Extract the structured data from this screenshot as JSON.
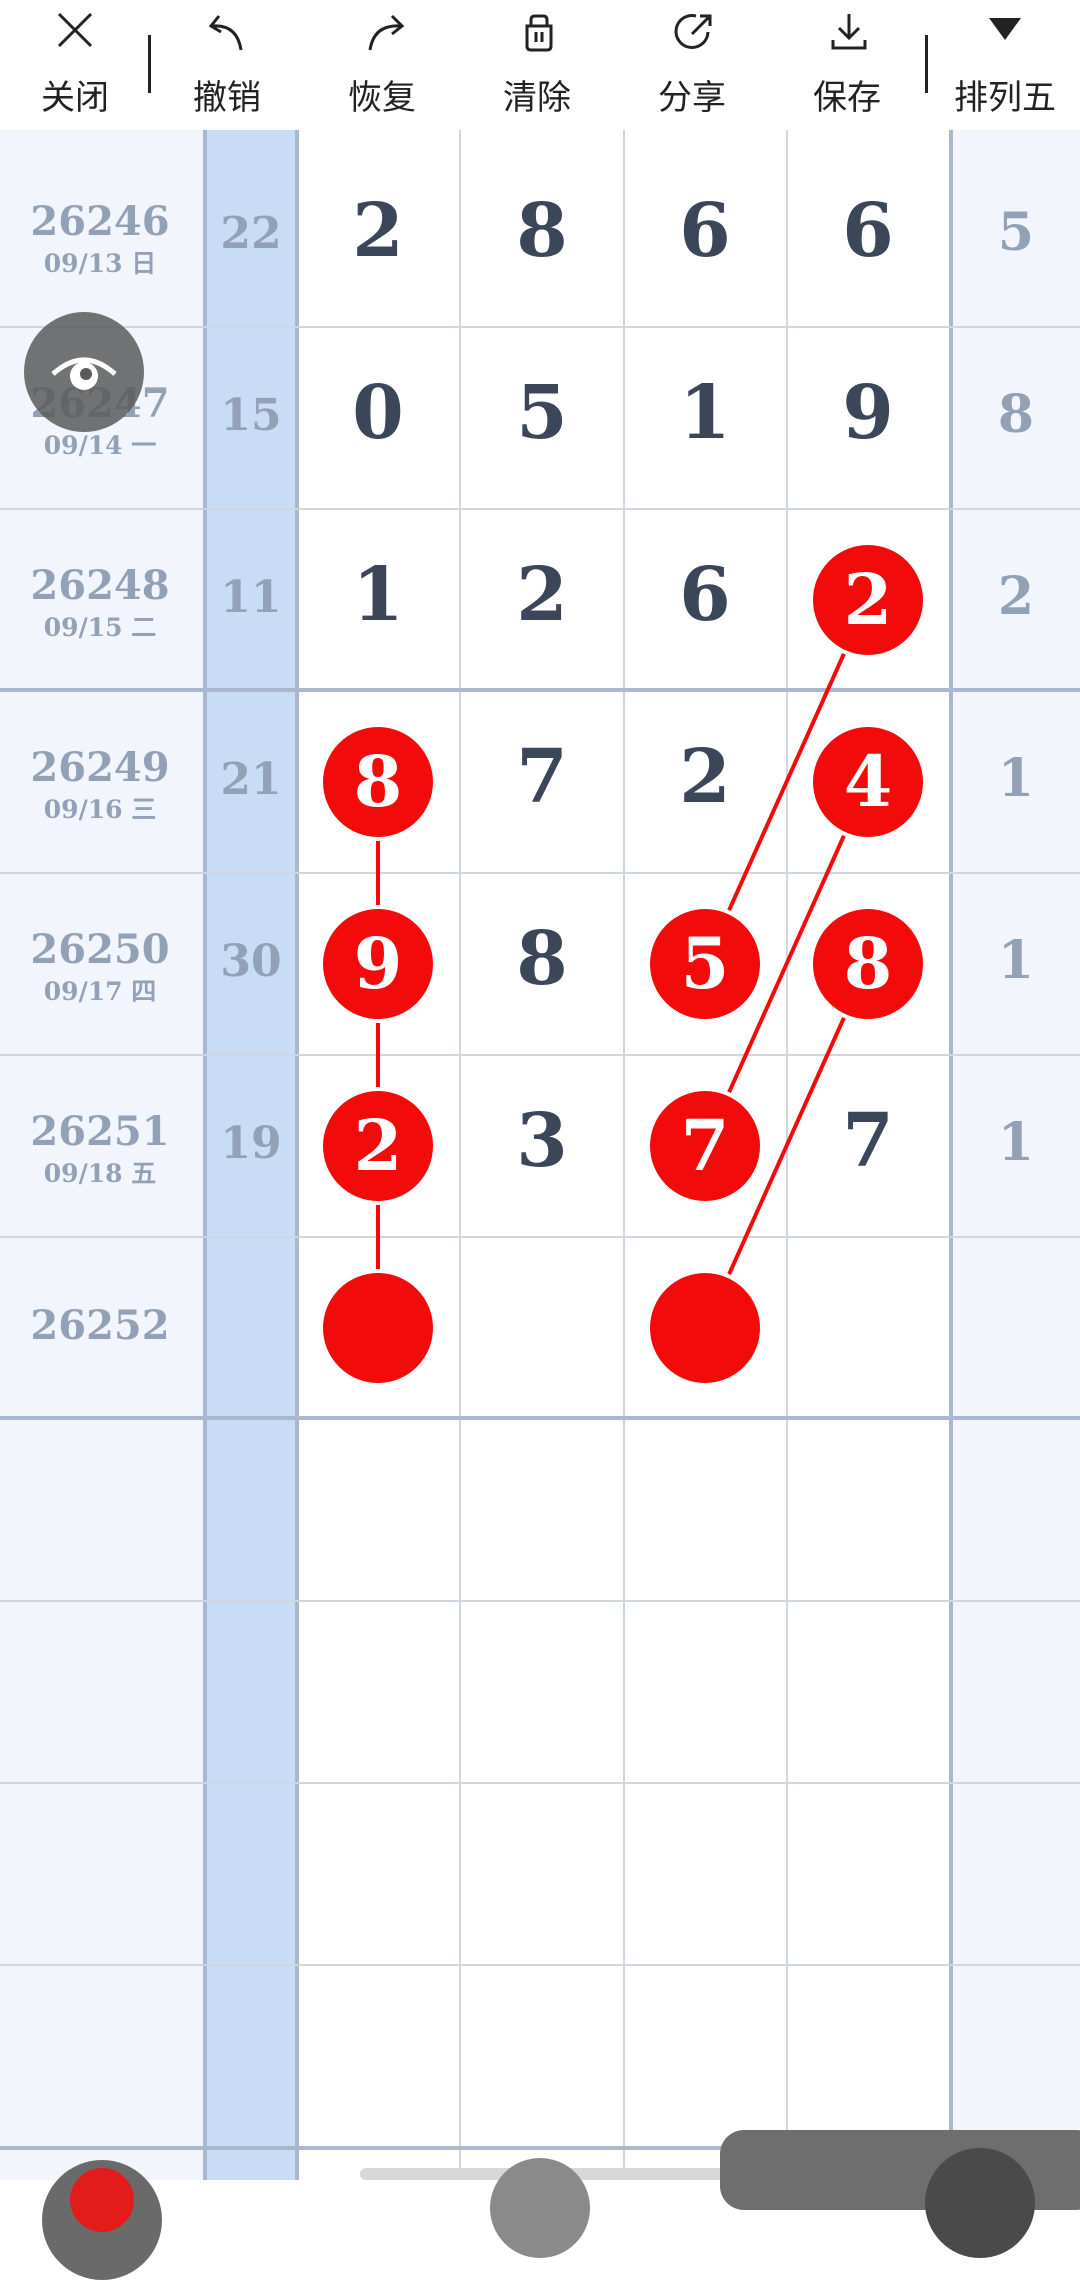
{
  "toolbar": {
    "close": "关闭",
    "undo": "撤销",
    "redo": "恢复",
    "clear": "清除",
    "share": "分享",
    "save": "保存",
    "lottery": "排列五"
  },
  "rows": [
    {
      "issue": "26246",
      "date": "09/13 日",
      "sum": "22",
      "d1": "2",
      "d2": "8",
      "d3": "6",
      "d4": "6",
      "last": "5"
    },
    {
      "issue": "26247",
      "date": "09/14 一",
      "sum": "15",
      "d1": "0",
      "d2": "5",
      "d3": "1",
      "d4": "9",
      "last": "8"
    },
    {
      "issue": "26248",
      "date": "09/15 二",
      "sum": "11",
      "d1": "1",
      "d2": "2",
      "d3": "6",
      "d4": "2",
      "last": "2"
    },
    {
      "issue": "26249",
      "date": "09/16 三",
      "sum": "21",
      "d1": "8",
      "d2": "7",
      "d3": "2",
      "d4": "4",
      "last": "1"
    },
    {
      "issue": "26250",
      "date": "09/17 四",
      "sum": "30",
      "d1": "9",
      "d2": "8",
      "d3": "5",
      "d4": "8",
      "last": "1"
    },
    {
      "issue": "26251",
      "date": "09/18 五",
      "sum": "19",
      "d1": "2",
      "d2": "3",
      "d3": "7",
      "d4": "7",
      "last": "1"
    },
    {
      "issue": "26252",
      "date": "",
      "sum": "",
      "d1": "",
      "d2": "",
      "d3": "",
      "d4": "",
      "last": ""
    }
  ],
  "highlighted": [
    {
      "row": 2,
      "col": 4
    },
    {
      "row": 3,
      "col": 1
    },
    {
      "row": 3,
      "col": 4
    },
    {
      "row": 4,
      "col": 1
    },
    {
      "row": 4,
      "col": 3
    },
    {
      "row": 4,
      "col": 4
    },
    {
      "row": 5,
      "col": 1
    },
    {
      "row": 5,
      "col": 3
    },
    {
      "row": 6,
      "col": 1
    },
    {
      "row": 6,
      "col": 3
    }
  ],
  "colors": {
    "accent": "#f30a0a",
    "sum_column": "#c9dcf5",
    "digit_text": "#3b4658",
    "muted_text": "#93a1b6"
  }
}
